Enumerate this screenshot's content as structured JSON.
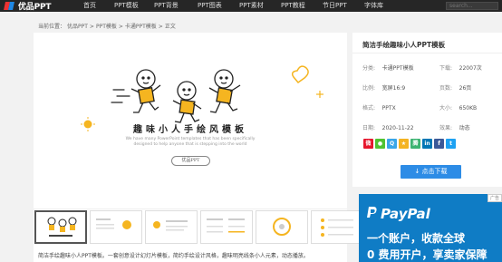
{
  "nav": {
    "logo_text": "优品PPT",
    "items": [
      "首页",
      "PPT模板",
      "PPT背景",
      "PPT图表",
      "PPT素材",
      "PPT教程",
      "节日PPT",
      "字体库"
    ],
    "search_placeholder": "search..."
  },
  "breadcrumb": [
    "当前位置：",
    "优品PPT",
    ">",
    "PPT模板",
    ">",
    "卡通PPT模板",
    ">",
    "正文"
  ],
  "preview": {
    "title": "趣味小人手绘风模板",
    "subtitle_line1": "We have many PowerPoint templates that has been specifically",
    "subtitle_line2": "designed to help anyone that is stepping into the world",
    "button_label": "优品PPT"
  },
  "description": "简洁手绘趣味小人PPT模板。一套创意设计幻灯片模板，简约手绘设计风格，趣味明亮线条小人元素，动态播放。",
  "sidebar": {
    "title": "简洁手绘趣味小人PPT模板",
    "meta": [
      {
        "k": "分类:",
        "v": "卡通PPT模板"
      },
      {
        "k": "下载:",
        "v": "22007次"
      },
      {
        "k": "比例:",
        "v": "宽屏16:9"
      },
      {
        "k": "页数:",
        "v": "26页"
      },
      {
        "k": "格式:",
        "v": "PPTX"
      },
      {
        "k": "大小:",
        "v": "650KB"
      },
      {
        "k": "日期:",
        "v": "2020-11-22"
      },
      {
        "k": "效果:",
        "v": "动态"
      }
    ],
    "shares": [
      {
        "icon": "weibo-icon",
        "color": "#e6162d",
        "glyph": "微"
      },
      {
        "icon": "wechat-icon",
        "color": "#51c332",
        "glyph": "微"
      },
      {
        "icon": "qq-icon",
        "color": "#3aa6e8",
        "glyph": "Q"
      },
      {
        "icon": "qzone-icon",
        "color": "#f4b321",
        "glyph": "★"
      },
      {
        "icon": "tencent-weibo-icon",
        "color": "#3cb371",
        "glyph": "腾"
      },
      {
        "icon": "linkedin-icon",
        "color": "#0077b5",
        "glyph": "in"
      },
      {
        "icon": "facebook-icon",
        "color": "#3b5998",
        "glyph": "f"
      },
      {
        "icon": "twitter-icon",
        "color": "#1da1f2",
        "glyph": "t"
      }
    ],
    "download_label": "↓ 点击下载"
  },
  "ad": {
    "tag": "广告",
    "brand": "PayPal",
    "line1": "一个账户，收款全球",
    "line2": "0 费用开户，享卖家保障"
  },
  "colors": {
    "nav_bg": "#262626",
    "accent_blue": "#2d8ce6",
    "cartoon_yellow": "#f5b520",
    "paypal_blue": "#0f7cc5"
  }
}
